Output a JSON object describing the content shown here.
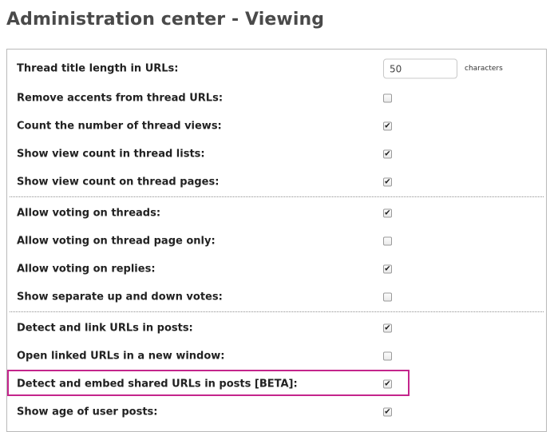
{
  "page": {
    "title": "Administration center - Viewing"
  },
  "settings": {
    "thread_title_length": {
      "label": "Thread title length in URLs:",
      "value": "50",
      "unit": "characters"
    },
    "remove_accents": {
      "label": "Remove accents from thread URLs:",
      "checked": false
    },
    "count_views": {
      "label": "Count the number of thread views:",
      "checked": true
    },
    "view_count_lists": {
      "label": "Show view count in thread lists:",
      "checked": true
    },
    "view_count_pages": {
      "label": "Show view count on thread pages:",
      "checked": true
    },
    "voting_threads": {
      "label": "Allow voting on threads:",
      "checked": true
    },
    "voting_thread_page_only": {
      "label": "Allow voting on thread page only:",
      "checked": false
    },
    "voting_replies": {
      "label": "Allow voting on replies:",
      "checked": true
    },
    "separate_votes": {
      "label": "Show separate up and down votes:",
      "checked": false
    },
    "detect_link_urls": {
      "label": "Detect and link URLs in posts:",
      "checked": true
    },
    "open_new_window": {
      "label": "Open linked URLs in a new window:",
      "checked": false
    },
    "embed_shared_urls": {
      "label": "Detect and embed shared URLs in posts [BETA]:",
      "checked": true
    },
    "show_post_age": {
      "label": "Show age of user posts:",
      "checked": true
    }
  }
}
